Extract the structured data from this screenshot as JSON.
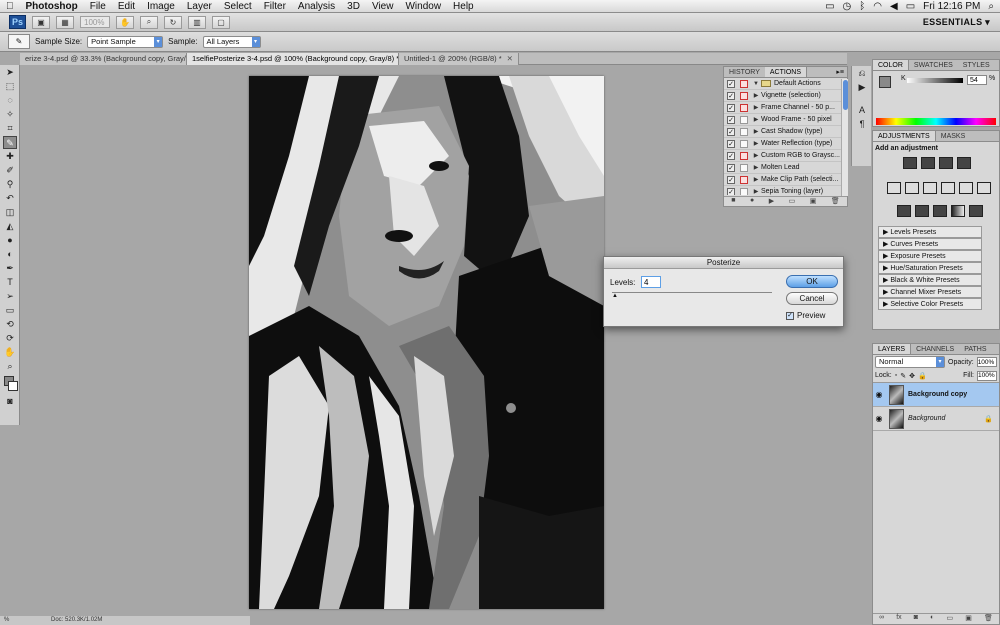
{
  "menubar": {
    "apple": "",
    "app": "Photoshop",
    "items": [
      "File",
      "Edit",
      "Image",
      "Layer",
      "Select",
      "Filter",
      "Analysis",
      "3D",
      "View",
      "Window",
      "Help"
    ],
    "clock": "Fri 12:16 PM"
  },
  "appbar": {
    "ps_label": "Ps",
    "zoom": "100%",
    "workspace": "ESSENTIALS ▾"
  },
  "options": {
    "sample_size_label": "Sample Size:",
    "sample_size_value": "Point Sample",
    "sample_label": "Sample:",
    "sample_value": "All Layers"
  },
  "tabs": [
    {
      "label": "erize 3-4.psd @ 33.3% (Background copy, Gray/8) *",
      "active": false
    },
    {
      "label": "1selfiePosterize 3-4.psd @ 100% (Background copy, Gray/8) *",
      "active": true
    },
    {
      "label": "Untitled-1 @ 200% (RGB/8) *",
      "active": false
    }
  ],
  "actions_panel": {
    "tabs": [
      "HISTORY",
      "ACTIONS"
    ],
    "active_tab": "ACTIONS",
    "set_name": "Default Actions",
    "items": [
      "Vignette (selection)",
      "Frame Channel - 50 p...",
      "Wood Frame - 50 pixel",
      "Cast Shadow (type)",
      "Water Reflection (type)",
      "Custom RGB to Graysc...",
      "Molten Lead",
      "Make Clip Path (selecti...",
      "Sepia Toning (layer)"
    ]
  },
  "color_panel": {
    "tabs": [
      "COLOR",
      "SWATCHES",
      "STYLES"
    ],
    "channel_label": "K",
    "value": "54",
    "unit": "%"
  },
  "adjustments_panel": {
    "tabs": [
      "ADJUSTMENTS",
      "MASKS"
    ],
    "heading": "Add an adjustment",
    "presets": [
      "Levels Presets",
      "Curves Presets",
      "Exposure Presets",
      "Hue/Saturation Presets",
      "Black & White Presets",
      "Channel Mixer Presets",
      "Selective Color Presets"
    ]
  },
  "layers_panel": {
    "tabs": [
      "LAYERS",
      "CHANNELS",
      "PATHS"
    ],
    "blend_mode": "Normal",
    "opacity_label": "Opacity:",
    "opacity": "100%",
    "lock_label": "Lock:",
    "fill_label": "Fill:",
    "fill": "100%",
    "layers": [
      {
        "name": "Background copy",
        "selected": true
      },
      {
        "name": "Background",
        "selected": false
      }
    ]
  },
  "posterize": {
    "title": "Posterize",
    "levels_label": "Levels:",
    "levels_value": "4",
    "ok": "OK",
    "cancel": "Cancel",
    "preview_label": "Preview",
    "preview_checked": true
  },
  "status": {
    "zoom": "%",
    "doc": "Doc: 520.3K/1.02M"
  },
  "colors": {
    "accent": "#5d9fe6",
    "selected_layer": "#a4c8f0"
  }
}
